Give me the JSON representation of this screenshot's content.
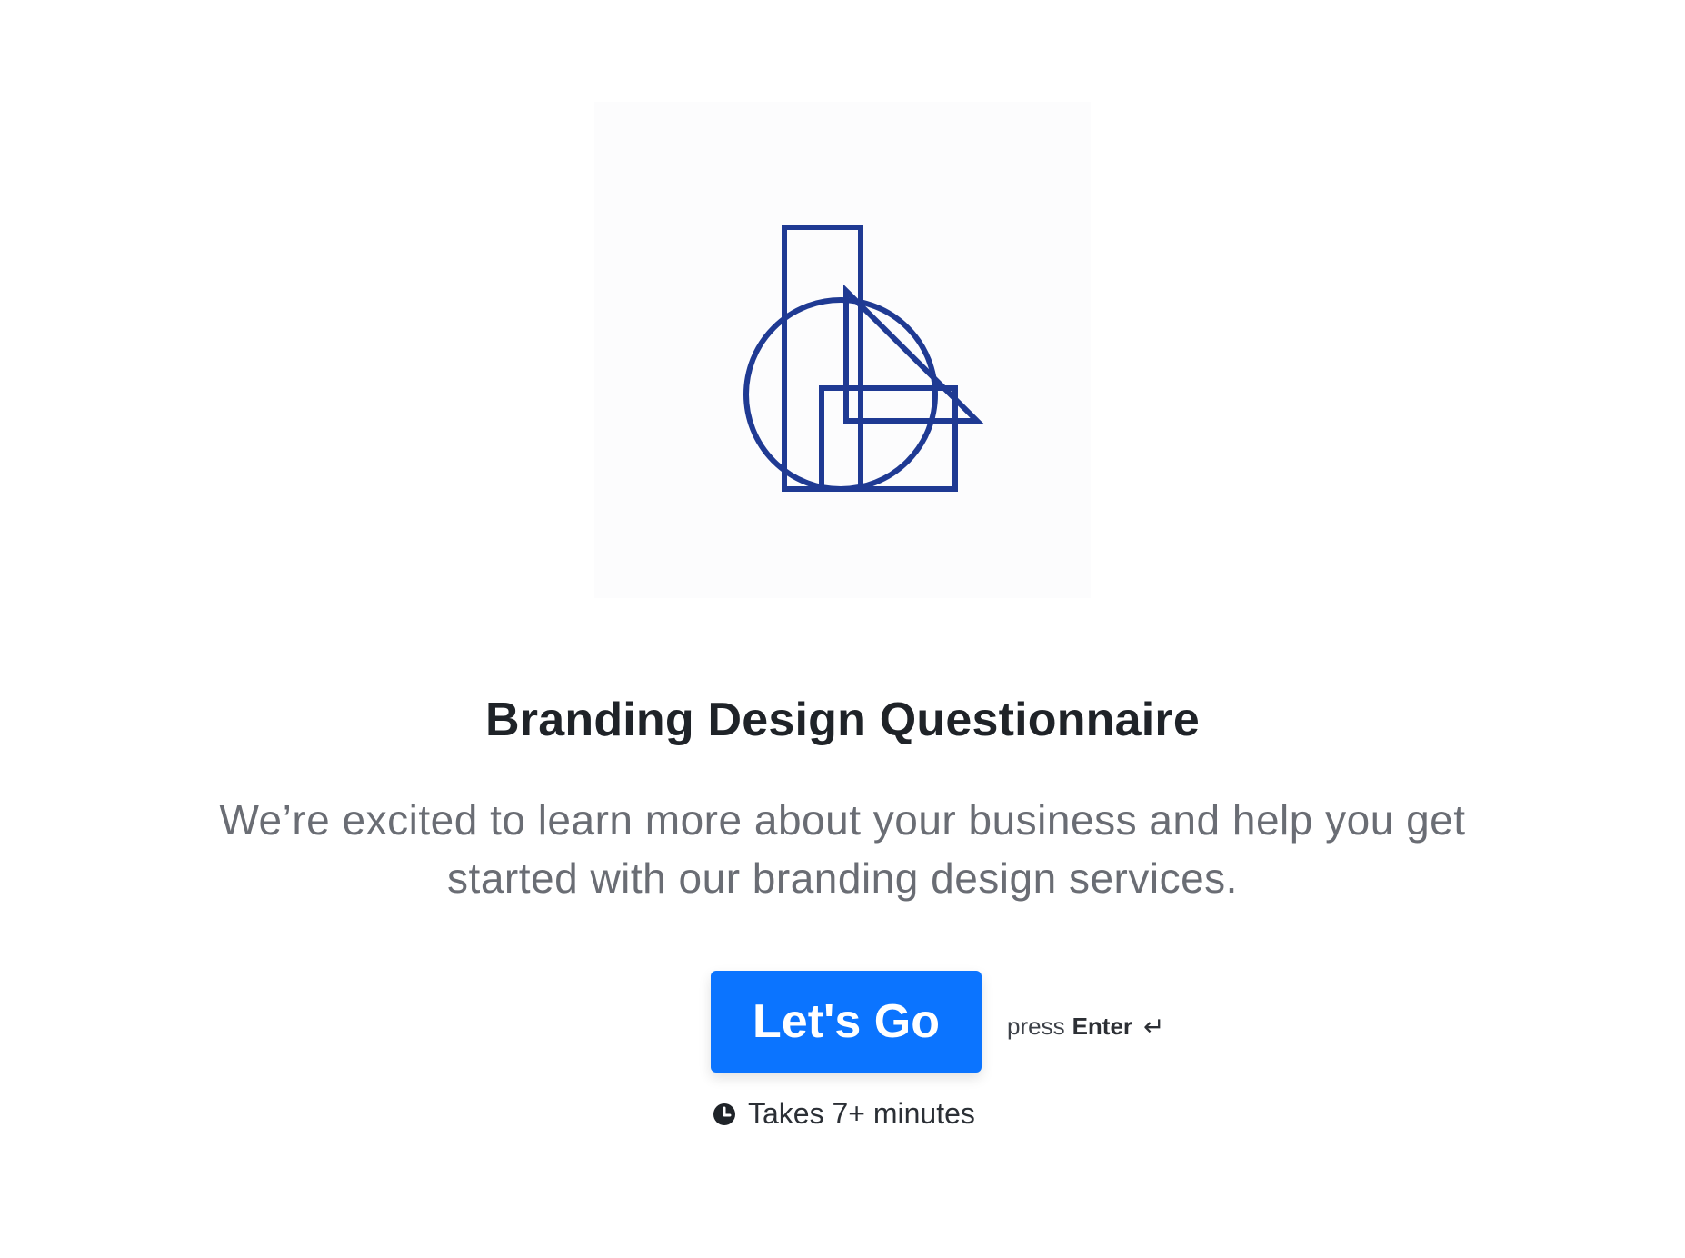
{
  "hero": {
    "title": "Branding Design Questionnaire",
    "description": "We’re excited to learn more about your business and help you get started with our branding design services.",
    "logo_icon": "geometric-logo-icon",
    "logo_color": "#1f3a93"
  },
  "cta": {
    "button_label": "Let's Go",
    "hint_prefix": "press",
    "hint_key": "Enter",
    "hint_icon": "enter-return-icon",
    "button_color": "#0b74ff"
  },
  "meta": {
    "duration_text": "Takes 7+ minutes",
    "duration_icon": "clock-icon"
  }
}
